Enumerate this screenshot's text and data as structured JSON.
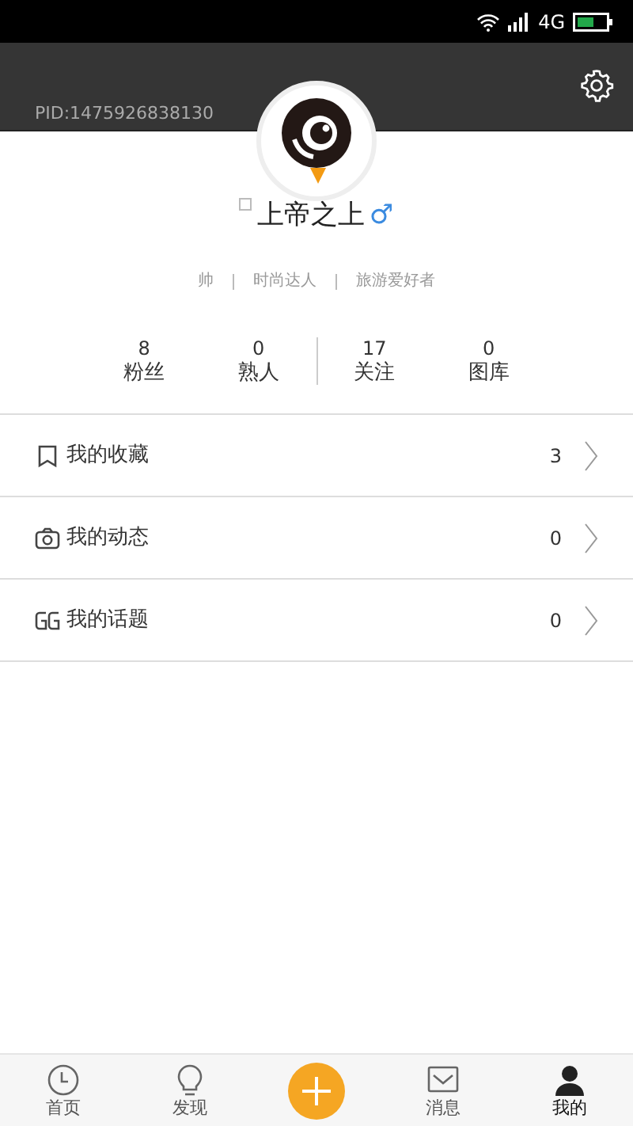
{
  "status_bar": {
    "network": "4G"
  },
  "header": {
    "pid": "PID:1475926838130"
  },
  "profile": {
    "name": "上帝之上",
    "gender": "♂",
    "tags": [
      "帅",
      "时尚达人",
      "旅游爱好者"
    ]
  },
  "stats": [
    {
      "value": "8",
      "label": "粉丝"
    },
    {
      "value": "0",
      "label": "熟人"
    },
    {
      "value": "17",
      "label": "关注"
    },
    {
      "value": "0",
      "label": "图库"
    }
  ],
  "menu": [
    {
      "kind": "bookmark",
      "label": "我的收藏",
      "count": "3"
    },
    {
      "kind": "camera",
      "label": "我的动态",
      "count": "0"
    },
    {
      "kind": "quote",
      "label": "我的话题",
      "count": "0"
    }
  ],
  "tab_bar": [
    {
      "kind": "clock",
      "label": "首页",
      "selected": false
    },
    {
      "kind": "bulb",
      "label": "发现",
      "selected": false
    },
    {
      "kind": "add"
    },
    {
      "kind": "mail",
      "label": "消息",
      "selected": false
    },
    {
      "kind": "person",
      "label": "我的",
      "selected": true
    }
  ]
}
